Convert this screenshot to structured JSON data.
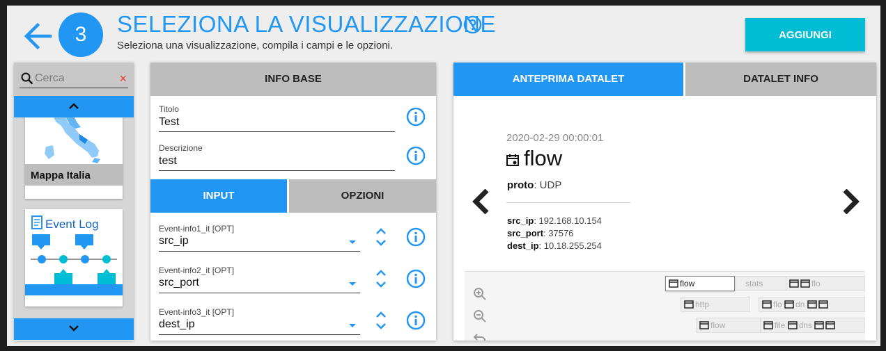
{
  "header": {
    "step_number": "3",
    "title": "SELEZIONA LA VISUALIZZAZIONE",
    "subtitle": "Seleziona una visualizzazione, compila i campi e le opzioni.",
    "add_label": "AGGIUNGI",
    "accent_color": "#2196f3",
    "button_color": "#00bcd4"
  },
  "search": {
    "placeholder": "Cerca",
    "clear_glyph": "×"
  },
  "visualizations": [
    {
      "label": "Mappa Italia",
      "icon": "italy-map-thumbnail"
    },
    {
      "label": "Event Log",
      "icon": "event-log-thumbnail"
    }
  ],
  "info_base": {
    "header": "INFO BASE",
    "title_label": "Titolo",
    "title_value": "Test",
    "description_label": "Descrizione",
    "description_value": "test"
  },
  "tabs": {
    "input": "INPUT",
    "options": "OPZIONI"
  },
  "inputs": [
    {
      "label": "Event-info1_it [OPT]",
      "value": "src_ip"
    },
    {
      "label": "Event-info2_it [OPT]",
      "value": "src_port"
    },
    {
      "label": "Event-info3_it [OPT]",
      "value": "dest_ip"
    }
  ],
  "right_tabs": {
    "preview": "ANTEPRIMA DATALET",
    "info": "DATALET INFO"
  },
  "preview": {
    "date": "2020-02-29 00:00:01",
    "title": "flow",
    "proto_key": "proto",
    "proto_value": ": UDP",
    "fields": [
      {
        "key": "src_ip",
        "value": ": 192.168.10.154"
      },
      {
        "key": "src_port",
        "value": ": 37576"
      },
      {
        "key": "dest_ip",
        "value": ": 10.18.255.254"
      }
    ]
  },
  "graph": {
    "nodes": [
      "flow",
      "stats",
      "flo",
      "http",
      "flo",
      "dn",
      "flow",
      "file",
      "dns"
    ]
  }
}
